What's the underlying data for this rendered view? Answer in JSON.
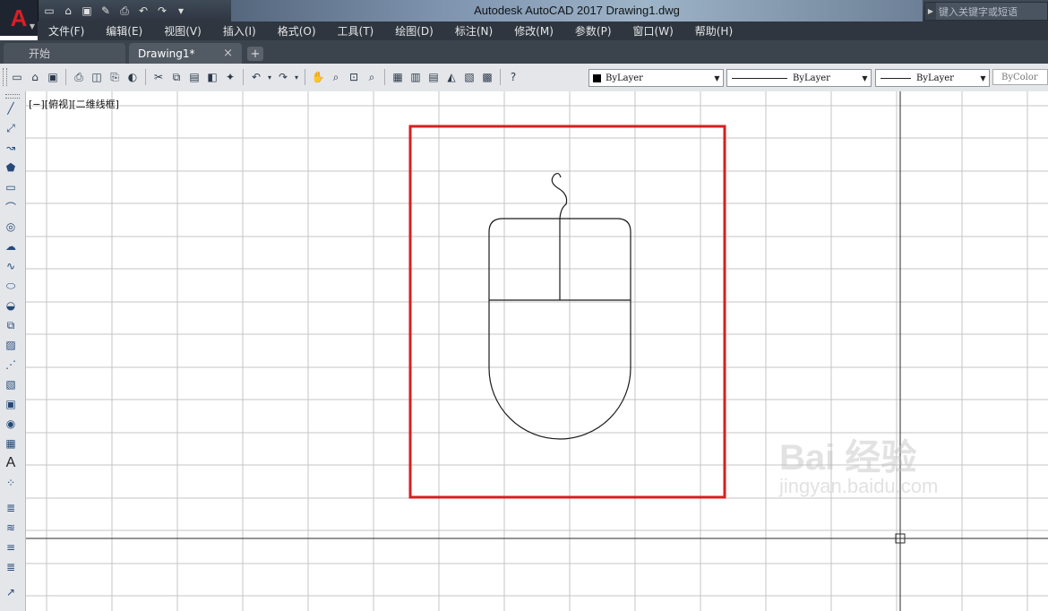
{
  "app": {
    "title": "Autodesk AutoCAD 2017    Drawing1.dwg",
    "logo_letter": "A",
    "search_placeholder": "键入关键字或短语"
  },
  "quick_access": [
    "new-icon",
    "open-icon",
    "save-icon",
    "save-as-icon",
    "print-icon",
    "undo-icon",
    "redo-icon",
    "customize-icon"
  ],
  "menubar": {
    "items": [
      "文件(F)",
      "编辑(E)",
      "视图(V)",
      "插入(I)",
      "格式(O)",
      "工具(T)",
      "绘图(D)",
      "标注(N)",
      "修改(M)",
      "参数(P)",
      "窗口(W)",
      "帮助(H)"
    ]
  },
  "tabs": {
    "start": "开始",
    "drawing": "Drawing1*",
    "close_glyph": "×",
    "add_glyph": "+"
  },
  "toolbar": {
    "layer_value": "ByLayer",
    "linetype_value": "ByLayer",
    "lineweight_value": "ByLayer",
    "plotstyle_value": "ByColor"
  },
  "viewport": {
    "label": "[−][俯视][二维线框]"
  },
  "drawing": {
    "object": "computer mouse",
    "highlight_color": "#d81e1e",
    "stroke_color": "#1a1a1a",
    "grid_color": "#c4c4c4",
    "crosshair_color": "#2a2a2a"
  },
  "watermark": {
    "main": "Bai 经验",
    "sub": "jingyan.baidu.com"
  },
  "sidebar_tools": [
    "line-icon",
    "construction-line-icon",
    "polyline-icon",
    "polygon-icon",
    "rectangle-icon",
    "arc-icon",
    "circle-icon",
    "revision-cloud-icon",
    "spline-icon",
    "ellipse-icon",
    "ellipse-arc-icon",
    "insert-block-icon",
    "make-block-icon",
    "point-icon",
    "hatch-icon",
    "gradient-icon",
    "region-icon",
    "table-icon",
    "text-icon",
    "add-selected-icon",
    "layer-icon",
    "layer-state-icon",
    "match-layer-icon",
    "layer-previous-icon",
    "layer-walk-icon"
  ]
}
